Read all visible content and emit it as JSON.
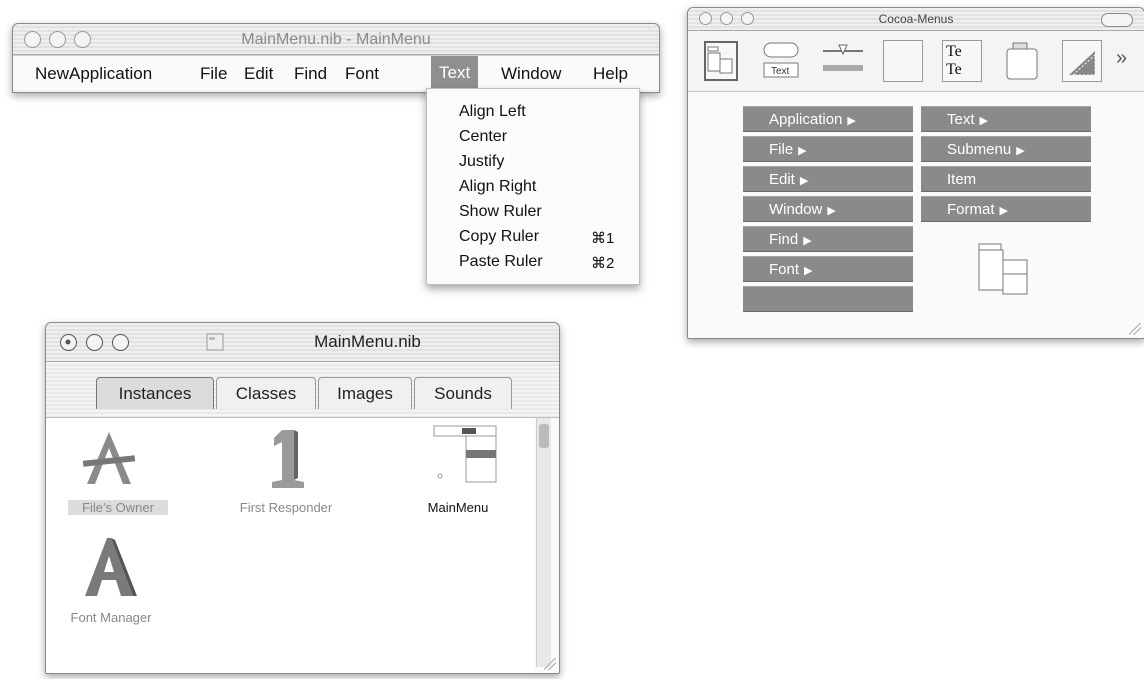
{
  "window_menu": {
    "title": "MainMenu.nib - MainMenu",
    "menubar": [
      "NewApplication",
      "File",
      "Edit",
      "Find",
      "Font",
      "Text",
      "Window",
      "Help"
    ],
    "selected": "Text",
    "dropdown": [
      {
        "label": "Align Left",
        "key": ""
      },
      {
        "label": "Center",
        "key": ""
      },
      {
        "label": "Justify",
        "key": ""
      },
      {
        "label": "Align Right",
        "key": ""
      },
      {
        "label": "Show Ruler",
        "key": ""
      },
      {
        "label": "Copy Ruler",
        "key": "⌘1"
      },
      {
        "label": "Paste Ruler",
        "key": "⌘2"
      }
    ]
  },
  "palette_window": {
    "title": "Cocoa-Menus",
    "palette_text_label": "Text",
    "text_icon_label": "Te\nTe",
    "overflow": "»",
    "menus_left": [
      "Application",
      "File",
      "Edit",
      "Window",
      "Find",
      "Font",
      ""
    ],
    "menus_right": [
      "Text",
      "Submenu",
      "Item",
      "Format"
    ],
    "menus_right_has_arrow": [
      true,
      true,
      false,
      true
    ],
    "menus_left_has_arrow": [
      true,
      true,
      true,
      true,
      true,
      true,
      false
    ]
  },
  "nib_window": {
    "title": "MainMenu.nib",
    "tabs": [
      "Instances",
      "Classes",
      "Images",
      "Sounds"
    ],
    "active_tab": "Instances",
    "instances": [
      "File's Owner",
      "First Responder",
      "MainMenu",
      "Font Manager"
    ]
  }
}
